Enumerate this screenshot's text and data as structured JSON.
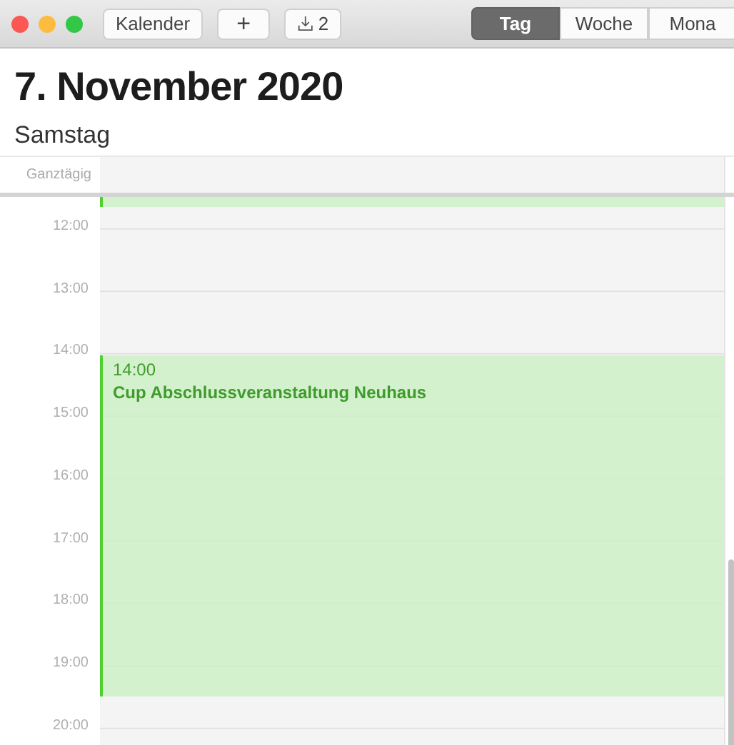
{
  "toolbar": {
    "calendars_button": "Kalender",
    "add_button": "+",
    "inbox_count": "2",
    "views": [
      {
        "label": "Tag",
        "selected": true
      },
      {
        "label": "Woche",
        "selected": false
      },
      {
        "label": "Mona",
        "selected": false
      }
    ]
  },
  "date_title": "7. November 2020",
  "weekday": "Samstag",
  "all_day_label": "Ganztägig",
  "hours": [
    "12:00",
    "13:00",
    "14:00",
    "15:00",
    "16:00",
    "17:00",
    "18:00",
    "19:00",
    "20:00"
  ],
  "events": [
    {
      "kind": "continued"
    },
    {
      "kind": "timed",
      "time": "14:00",
      "title": "Cup Abschlussveranstaltung Neuhaus"
    }
  ]
}
